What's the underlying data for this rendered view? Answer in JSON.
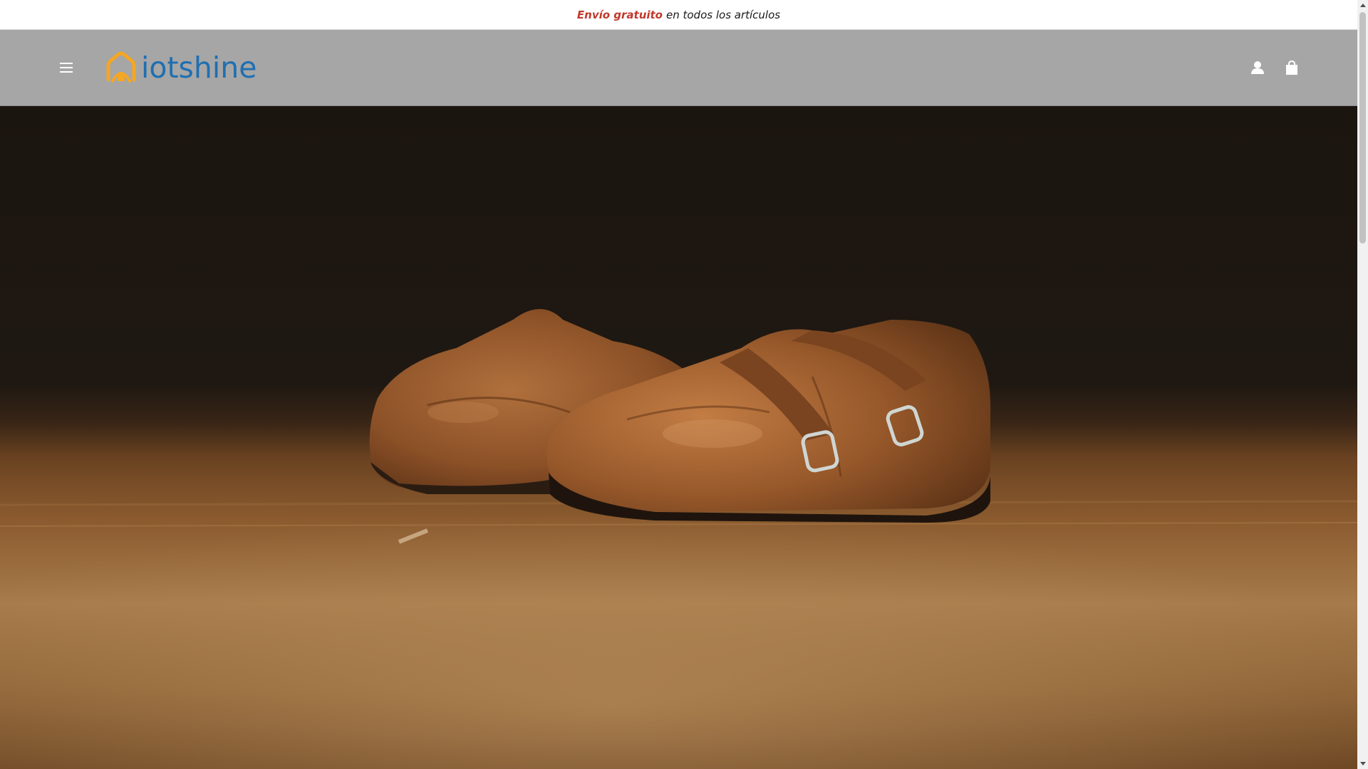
{
  "announcement": {
    "highlight": "Envío gratuito",
    "text": "en todos los artículos",
    "highlight_color": "#c0392b"
  },
  "header": {
    "logo_text": "iotshine",
    "logo_color": "#1f6fb2",
    "logo_icon_color": "#f5a623",
    "background": "#a6a6a6",
    "menu_icon": "hamburger-menu-icon",
    "account_icon": "user-icon",
    "cart_icon": "shopping-bag-icon"
  },
  "hero": {
    "image": "brown-leather-monk-strap-shoes-on-wooden-floor"
  }
}
